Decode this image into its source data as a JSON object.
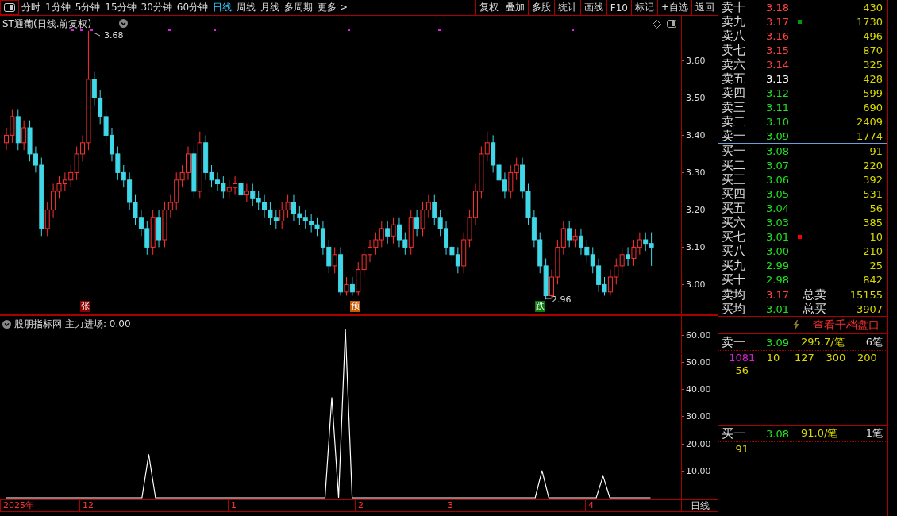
{
  "toolbar": {
    "periods": [
      {
        "label": "分时",
        "selected": false
      },
      {
        "label": "1分钟",
        "selected": false
      },
      {
        "label": "5分钟",
        "selected": false
      },
      {
        "label": "15分钟",
        "selected": false
      },
      {
        "label": "30分钟",
        "selected": false
      },
      {
        "label": "60分钟",
        "selected": false
      },
      {
        "label": "日线",
        "selected": true
      },
      {
        "label": "周线",
        "selected": false
      },
      {
        "label": "月线",
        "selected": false
      },
      {
        "label": "多周期",
        "selected": false
      },
      {
        "label": "更多 >",
        "selected": false
      }
    ],
    "buttons": [
      "复权",
      "叠加",
      "多股",
      "统计",
      "画线",
      "F10",
      "标记",
      "+自选",
      "返回"
    ]
  },
  "price_chart": {
    "title": "ST通葡(日线.前复权)",
    "high_label": "3.68",
    "low_label": "2.96",
    "signals": [
      {
        "label": "张",
        "kind": "rise"
      },
      {
        "label": "预",
        "kind": "warn"
      },
      {
        "label": "跌",
        "kind": "fall"
      }
    ],
    "chart_data": {
      "type": "candlestick",
      "ylim": [
        2.92,
        3.72
      ],
      "yticks": [
        {
          "value": 3.6,
          "label": "3.60"
        },
        {
          "value": 3.5,
          "label": "3.50"
        },
        {
          "value": 3.4,
          "label": "3.40"
        },
        {
          "value": 3.3,
          "label": "3.30"
        },
        {
          "value": 3.2,
          "label": "3.20"
        },
        {
          "value": 3.1,
          "label": "3.10"
        },
        {
          "value": 3.0,
          "label": "3.00"
        }
      ],
      "ohlc": [
        [
          3.38,
          3.42,
          3.36,
          3.4
        ],
        [
          3.4,
          3.47,
          3.38,
          3.45
        ],
        [
          3.45,
          3.47,
          3.36,
          3.38
        ],
        [
          3.38,
          3.44,
          3.36,
          3.42
        ],
        [
          3.42,
          3.44,
          3.33,
          3.35
        ],
        [
          3.35,
          3.37,
          3.3,
          3.32
        ],
        [
          3.32,
          3.34,
          3.13,
          3.15
        ],
        [
          3.15,
          3.22,
          3.13,
          3.2
        ],
        [
          3.2,
          3.27,
          3.18,
          3.25
        ],
        [
          3.25,
          3.29,
          3.23,
          3.27
        ],
        [
          3.27,
          3.3,
          3.25,
          3.28
        ],
        [
          3.28,
          3.32,
          3.26,
          3.3
        ],
        [
          3.3,
          3.37,
          3.28,
          3.35
        ],
        [
          3.35,
          3.4,
          3.33,
          3.38
        ],
        [
          3.38,
          3.68,
          3.36,
          3.55
        ],
        [
          3.55,
          3.57,
          3.48,
          3.5
        ],
        [
          3.5,
          3.52,
          3.43,
          3.45
        ],
        [
          3.45,
          3.47,
          3.38,
          3.4
        ],
        [
          3.4,
          3.42,
          3.33,
          3.35
        ],
        [
          3.35,
          3.37,
          3.28,
          3.3
        ],
        [
          3.3,
          3.32,
          3.26,
          3.28
        ],
        [
          3.28,
          3.3,
          3.2,
          3.22
        ],
        [
          3.22,
          3.24,
          3.16,
          3.18
        ],
        [
          3.18,
          3.2,
          3.13,
          3.15
        ],
        [
          3.15,
          3.17,
          3.08,
          3.1
        ],
        [
          3.1,
          3.2,
          3.08,
          3.18
        ],
        [
          3.18,
          3.2,
          3.1,
          3.12
        ],
        [
          3.12,
          3.22,
          3.1,
          3.2
        ],
        [
          3.2,
          3.24,
          3.18,
          3.22
        ],
        [
          3.22,
          3.3,
          3.2,
          3.28
        ],
        [
          3.28,
          3.32,
          3.26,
          3.3
        ],
        [
          3.3,
          3.37,
          3.28,
          3.35
        ],
        [
          3.35,
          3.37,
          3.23,
          3.25
        ],
        [
          3.25,
          3.41,
          3.23,
          3.38
        ],
        [
          3.38,
          3.4,
          3.28,
          3.3
        ],
        [
          3.3,
          3.32,
          3.26,
          3.28
        ],
        [
          3.28,
          3.3,
          3.25,
          3.27
        ],
        [
          3.27,
          3.29,
          3.23,
          3.25
        ],
        [
          3.25,
          3.28,
          3.23,
          3.26
        ],
        [
          3.26,
          3.29,
          3.24,
          3.27
        ],
        [
          3.27,
          3.29,
          3.22,
          3.24
        ],
        [
          3.24,
          3.27,
          3.22,
          3.25
        ],
        [
          3.25,
          3.27,
          3.21,
          3.23
        ],
        [
          3.23,
          3.25,
          3.2,
          3.22
        ],
        [
          3.22,
          3.24,
          3.18,
          3.2
        ],
        [
          3.2,
          3.22,
          3.16,
          3.18
        ],
        [
          3.18,
          3.2,
          3.15,
          3.17
        ],
        [
          3.17,
          3.22,
          3.15,
          3.2
        ],
        [
          3.2,
          3.24,
          3.18,
          3.22
        ],
        [
          3.22,
          3.24,
          3.17,
          3.19
        ],
        [
          3.19,
          3.21,
          3.16,
          3.18
        ],
        [
          3.18,
          3.2,
          3.15,
          3.17
        ],
        [
          3.17,
          3.19,
          3.14,
          3.16
        ],
        [
          3.16,
          3.18,
          3.13,
          3.15
        ],
        [
          3.15,
          3.17,
          3.08,
          3.1
        ],
        [
          3.1,
          3.12,
          3.03,
          3.05
        ],
        [
          3.05,
          3.1,
          3.03,
          3.08
        ],
        [
          3.08,
          3.1,
          2.97,
          2.98
        ],
        [
          2.98,
          3.02,
          2.97,
          3.0
        ],
        [
          3.0,
          3.02,
          2.97,
          2.98
        ],
        [
          2.98,
          3.06,
          2.97,
          3.04
        ],
        [
          3.04,
          3.1,
          3.02,
          3.08
        ],
        [
          3.08,
          3.12,
          3.06,
          3.1
        ],
        [
          3.1,
          3.14,
          3.08,
          3.12
        ],
        [
          3.12,
          3.17,
          3.1,
          3.15
        ],
        [
          3.15,
          3.17,
          3.11,
          3.13
        ],
        [
          3.13,
          3.18,
          3.11,
          3.16
        ],
        [
          3.16,
          3.18,
          3.1,
          3.12
        ],
        [
          3.12,
          3.14,
          3.08,
          3.1
        ],
        [
          3.1,
          3.2,
          3.08,
          3.18
        ],
        [
          3.18,
          3.2,
          3.13,
          3.15
        ],
        [
          3.15,
          3.22,
          3.13,
          3.2
        ],
        [
          3.2,
          3.24,
          3.18,
          3.22
        ],
        [
          3.22,
          3.24,
          3.16,
          3.18
        ],
        [
          3.18,
          3.2,
          3.13,
          3.15
        ],
        [
          3.15,
          3.17,
          3.08,
          3.1
        ],
        [
          3.1,
          3.12,
          3.06,
          3.08
        ],
        [
          3.08,
          3.1,
          3.03,
          3.05
        ],
        [
          3.05,
          3.14,
          3.03,
          3.12
        ],
        [
          3.12,
          3.2,
          3.1,
          3.18
        ],
        [
          3.18,
          3.27,
          3.16,
          3.25
        ],
        [
          3.25,
          3.37,
          3.23,
          3.35
        ],
        [
          3.35,
          3.41,
          3.33,
          3.38
        ],
        [
          3.38,
          3.4,
          3.3,
          3.32
        ],
        [
          3.32,
          3.34,
          3.26,
          3.28
        ],
        [
          3.28,
          3.3,
          3.23,
          3.25
        ],
        [
          3.25,
          3.32,
          3.23,
          3.3
        ],
        [
          3.3,
          3.34,
          3.28,
          3.32
        ],
        [
          3.32,
          3.34,
          3.23,
          3.25
        ],
        [
          3.25,
          3.27,
          3.16,
          3.18
        ],
        [
          3.18,
          3.2,
          3.1,
          3.12
        ],
        [
          3.12,
          3.14,
          3.03,
          3.05
        ],
        [
          3.05,
          3.07,
          2.96,
          2.97
        ],
        [
          2.97,
          3.04,
          2.96,
          3.02
        ],
        [
          3.02,
          3.12,
          3.0,
          3.1
        ],
        [
          3.1,
          3.17,
          3.08,
          3.15
        ],
        [
          3.15,
          3.17,
          3.1,
          3.12
        ],
        [
          3.12,
          3.15,
          3.1,
          3.13
        ],
        [
          3.13,
          3.15,
          3.08,
          3.1
        ],
        [
          3.1,
          3.12,
          3.06,
          3.08
        ],
        [
          3.08,
          3.1,
          3.03,
          3.05
        ],
        [
          3.05,
          3.07,
          2.98,
          3.0
        ],
        [
          3.0,
          3.02,
          2.97,
          2.98
        ],
        [
          2.98,
          3.04,
          2.97,
          3.02
        ],
        [
          3.02,
          3.07,
          3.0,
          3.05
        ],
        [
          3.05,
          3.1,
          3.03,
          3.08
        ],
        [
          3.08,
          3.1,
          3.05,
          3.07
        ],
        [
          3.07,
          3.12,
          3.05,
          3.1
        ],
        [
          3.1,
          3.14,
          3.08,
          3.12
        ],
        [
          3.12,
          3.14,
          3.09,
          3.11
        ],
        [
          3.11,
          3.14,
          3.05,
          3.1
        ]
      ]
    }
  },
  "indicator": {
    "title": "股朋指标网",
    "reading": "主力进场: 0.00",
    "chart_data": {
      "type": "line",
      "series": [
        {
          "color": "#ffffff",
          "values": [
            0,
            0,
            0,
            0,
            0,
            0,
            0,
            0,
            0,
            0,
            0,
            0,
            0,
            0,
            0,
            0,
            0,
            0,
            0,
            0,
            0,
            16,
            0,
            0,
            0,
            0,
            0,
            0,
            0,
            0,
            0,
            0,
            0,
            0,
            0,
            0,
            0,
            0,
            0,
            0,
            0,
            0,
            0,
            0,
            0,
            0,
            0,
            0,
            37,
            0,
            62,
            0,
            0,
            0,
            0,
            0,
            0,
            0,
            0,
            0,
            0,
            0,
            0,
            0,
            0,
            0,
            0,
            0,
            0,
            0,
            0,
            0,
            0,
            0,
            0,
            0,
            0,
            0,
            0,
            10,
            0,
            0,
            0,
            0,
            0,
            0,
            0,
            0,
            8,
            0,
            0,
            0,
            0,
            0,
            0,
            0
          ]
        }
      ],
      "ylim": [
        0,
        67
      ],
      "yticks": [
        {
          "value": 10,
          "label": "10.00"
        },
        {
          "value": 20,
          "label": "20.00"
        },
        {
          "value": 30,
          "label": "30.00"
        },
        {
          "value": 40,
          "label": "40.00"
        },
        {
          "value": 50,
          "label": "50.00"
        },
        {
          "value": 60,
          "label": "60.00"
        }
      ]
    }
  },
  "date_axis": [
    "2025年",
    "12",
    "1",
    "2",
    "3",
    "4"
  ],
  "period_label": "日线",
  "order_book": {
    "asks": [
      {
        "label": "卖十",
        "price": "3.18",
        "volume": "430",
        "kind": "up"
      },
      {
        "label": "卖九",
        "price": "3.17",
        "volume": "1730",
        "kind": "up",
        "color": "#00a000"
      },
      {
        "label": "卖八",
        "price": "3.16",
        "volume": "496",
        "kind": "up"
      },
      {
        "label": "卖七",
        "price": "3.15",
        "volume": "870",
        "kind": "up"
      },
      {
        "label": "卖六",
        "price": "3.14",
        "volume": "325",
        "kind": "up"
      },
      {
        "label": "卖五",
        "price": "3.13",
        "volume": "428",
        "kind": "flat"
      },
      {
        "label": "卖四",
        "price": "3.12",
        "volume": "599",
        "kind": "down"
      },
      {
        "label": "卖三",
        "price": "3.11",
        "volume": "690",
        "kind": "down"
      },
      {
        "label": "卖二",
        "price": "3.10",
        "volume": "2409",
        "kind": "down"
      },
      {
        "label": "卖一",
        "price": "3.09",
        "volume": "1774",
        "kind": "down"
      }
    ],
    "bids": [
      {
        "label": "买一",
        "price": "3.08",
        "volume": "91",
        "kind": "down"
      },
      {
        "label": "买二",
        "price": "3.07",
        "volume": "220",
        "kind": "down"
      },
      {
        "label": "买三",
        "price": "3.06",
        "volume": "392",
        "kind": "down"
      },
      {
        "label": "买四",
        "price": "3.05",
        "volume": "531",
        "kind": "down"
      },
      {
        "label": "买五",
        "price": "3.04",
        "volume": "56",
        "kind": "down"
      },
      {
        "label": "买六",
        "price": "3.03",
        "volume": "385",
        "kind": "down"
      },
      {
        "label": "买七",
        "price": "3.01",
        "volume": "10",
        "kind": "down",
        "color": "#ff0000"
      },
      {
        "label": "买八",
        "price": "3.00",
        "volume": "210",
        "kind": "down"
      },
      {
        "label": "买九",
        "price": "2.99",
        "volume": "25",
        "kind": "down"
      },
      {
        "label": "买十",
        "price": "2.98",
        "volume": "842",
        "kind": "down"
      }
    ],
    "summary": [
      {
        "label": "卖均",
        "price": "3.17",
        "total_label": "总卖",
        "total": "15155",
        "kind": "up"
      },
      {
        "label": "买均",
        "price": "3.01",
        "total_label": "总买",
        "total": "3907",
        "kind": "down"
      }
    ],
    "depth_link": "查看千档盘口",
    "queues": [
      {
        "label": "卖一",
        "price": "3.09",
        "average": "295.7/笔",
        "count": "6笔",
        "orders": [
          {
            "value": "1081",
            "kind": "large"
          },
          {
            "value": "10",
            "kind": "normal"
          },
          {
            "value": "127",
            "kind": "normal"
          },
          {
            "value": "300",
            "kind": "normal"
          },
          {
            "value": "200",
            "kind": "normal"
          },
          {
            "value": "56",
            "kind": "normal"
          }
        ]
      },
      {
        "label": "买一",
        "price": "3.08",
        "average": "91.0/笔",
        "count": "1笔",
        "orders": [
          {
            "value": "91",
            "kind": "normal"
          }
        ]
      }
    ]
  }
}
